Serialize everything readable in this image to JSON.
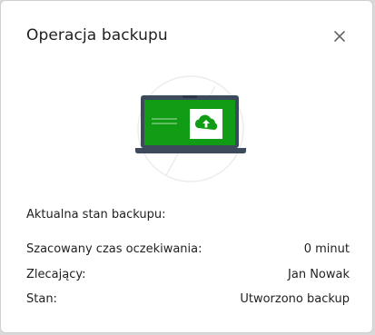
{
  "dialog": {
    "title": "Operacja backupu",
    "close_icon": "close-icon",
    "illustration": "laptop-cloud-upload-icon",
    "colors": {
      "screen_green": "#119c16",
      "laptop_frame": "#3d4a5c",
      "cloud_bg": "#ffffff"
    }
  },
  "status": {
    "section_label": "Aktualna stan backupu:",
    "rows": [
      {
        "label": "Szacowany czas oczekiwania:",
        "value": "0 minut"
      },
      {
        "label": "Zlecający:",
        "value": "Jan Nowak"
      },
      {
        "label": "Stan:",
        "value": "Utworzono backup"
      }
    ]
  }
}
